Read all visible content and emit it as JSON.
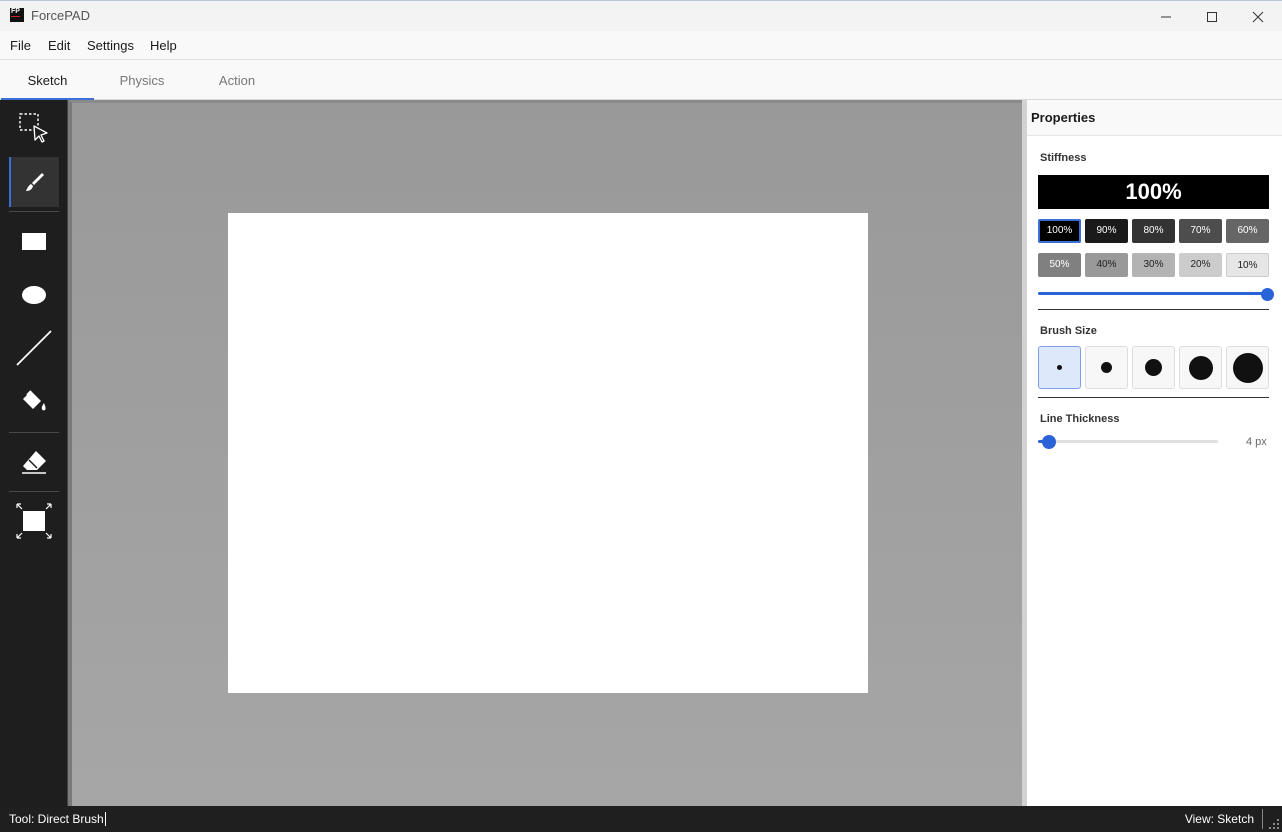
{
  "window": {
    "title": "ForcePAD",
    "logo_text": "FP"
  },
  "menu": {
    "items": [
      "File",
      "Edit",
      "Settings",
      "Help"
    ]
  },
  "tabs": [
    {
      "label": "Sketch",
      "active": true
    },
    {
      "label": "Physics",
      "active": false
    },
    {
      "label": "Action",
      "active": false
    }
  ],
  "tools": [
    {
      "icon": "select-icon",
      "active": false
    },
    {
      "icon": "brush-icon",
      "active": true
    },
    {
      "icon": "rectangle-icon",
      "active": false
    },
    {
      "icon": "ellipse-icon",
      "active": false
    },
    {
      "icon": "line-icon",
      "active": false
    },
    {
      "icon": "fill-bucket-icon",
      "active": false
    },
    {
      "icon": "eraser-icon",
      "active": false
    },
    {
      "icon": "fit-to-screen-icon",
      "active": false
    }
  ],
  "properties": {
    "title": "Properties",
    "stiffness": {
      "label": "Stiffness",
      "display": "100%",
      "value_percent": 100,
      "presets": [
        "100%",
        "90%",
        "80%",
        "70%",
        "60%",
        "50%",
        "40%",
        "30%",
        "20%",
        "10%"
      ],
      "selected": "100%"
    },
    "brush_size": {
      "label": "Brush Size",
      "selected_index": 0,
      "option_count": 5
    },
    "line_thickness": {
      "label": "Line Thickness",
      "value_label": "4 px",
      "value_fraction": 0.06
    }
  },
  "status": {
    "tool": "Tool: Direct Brush",
    "view": "View: Sketch"
  },
  "colors": {
    "accent": "#2a62d8",
    "rail_bg": "#1e1e1e",
    "canvas_bg": "#a0a0a0",
    "status_bg": "#1f1f1f"
  }
}
